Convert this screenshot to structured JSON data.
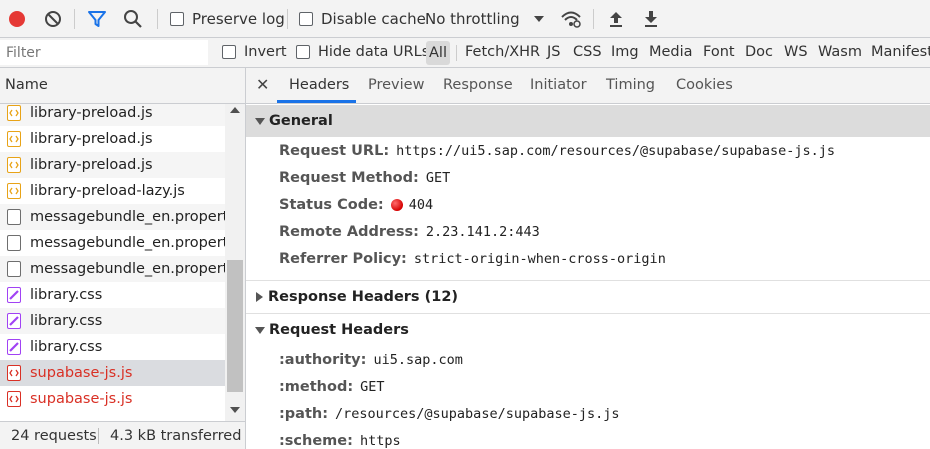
{
  "toolbar": {
    "preserve_log": "Preserve log",
    "disable_cache": "Disable cache",
    "throttling": "No throttling"
  },
  "filterbar": {
    "filter_placeholder": "Filter",
    "invert": "Invert",
    "hide_data_urls": "Hide data URLs",
    "all": "All",
    "types": [
      "Fetch/XHR",
      "JS",
      "CSS",
      "Img",
      "Media",
      "Font",
      "Doc",
      "WS",
      "Wasm",
      "Manifest"
    ]
  },
  "requests": {
    "column_name": "Name",
    "rows": [
      {
        "name": "library-preload.js",
        "icon": "js-file-icon",
        "error": false
      },
      {
        "name": "library-preload.js",
        "icon": "js-file-icon",
        "error": false
      },
      {
        "name": "library-preload.js",
        "icon": "js-file-icon",
        "error": false
      },
      {
        "name": "library-preload-lazy.js",
        "icon": "js-file-icon",
        "error": false
      },
      {
        "name": "messagebundle_en.properties",
        "icon": "document-icon",
        "error": false
      },
      {
        "name": "messagebundle_en.properties",
        "icon": "document-icon",
        "error": false
      },
      {
        "name": "messagebundle_en.properties",
        "icon": "document-icon",
        "error": false
      },
      {
        "name": "library.css",
        "icon": "css-file-icon",
        "error": false
      },
      {
        "name": "library.css",
        "icon": "css-file-icon",
        "error": false
      },
      {
        "name": "library.css",
        "icon": "css-file-icon",
        "error": false
      },
      {
        "name": "supabase-js.js",
        "icon": "js-error-icon",
        "error": true
      },
      {
        "name": "supabase-js.js",
        "icon": "js-error-icon",
        "error": true
      }
    ],
    "summary_requests": "24 requests",
    "summary_transferred": "4.3 kB transferred"
  },
  "details": {
    "tabs": [
      "Headers",
      "Preview",
      "Response",
      "Initiator",
      "Timing",
      "Cookies"
    ],
    "active_tab": "Headers",
    "general_title": "General",
    "general": [
      {
        "key": "Request URL:",
        "value": "https://ui5.sap.com/resources/@supabase/supabase-js.js"
      },
      {
        "key": "Request Method:",
        "value": "GET"
      },
      {
        "key": "Status Code:",
        "value": "404"
      },
      {
        "key": "Remote Address:",
        "value": "2.23.141.2:443"
      },
      {
        "key": "Referrer Policy:",
        "value": "strict-origin-when-cross-origin"
      }
    ],
    "response_headers_title": "Response Headers (12)",
    "request_headers_title": "Request Headers",
    "request_headers": [
      {
        "key": ":authority:",
        "value": "ui5.sap.com"
      },
      {
        "key": ":method:",
        "value": "GET"
      },
      {
        "key": ":path:",
        "value": "/resources/@supabase/supabase-js.js"
      },
      {
        "key": ":scheme:",
        "value": "https"
      }
    ]
  },
  "colors": {
    "accent": "#1a73e8",
    "record": "#e53935",
    "error_text": "#d93025",
    "js_icon": "#e8a317",
    "css_icon": "#a142f4"
  }
}
